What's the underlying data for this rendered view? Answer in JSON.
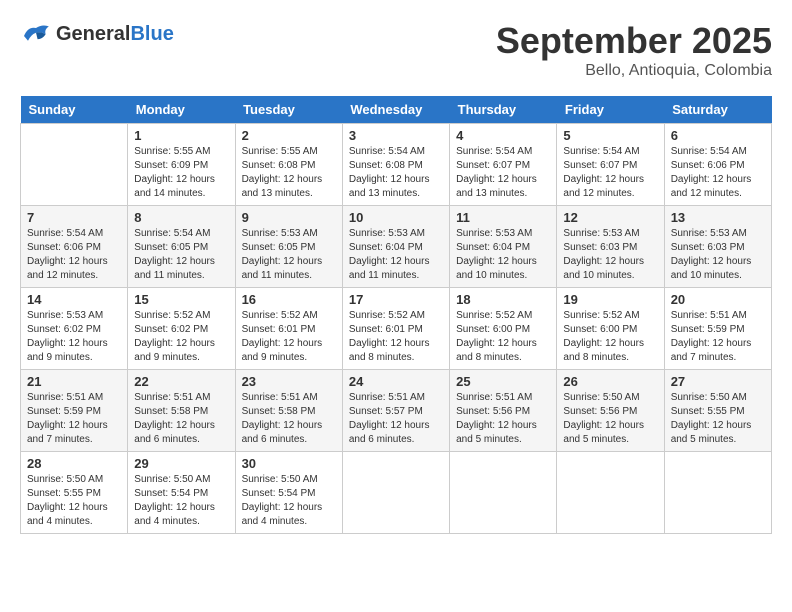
{
  "header": {
    "logo_general": "General",
    "logo_blue": "Blue",
    "month_title": "September 2025",
    "location": "Bello, Antioquia, Colombia"
  },
  "days_of_week": [
    "Sunday",
    "Monday",
    "Tuesday",
    "Wednesday",
    "Thursday",
    "Friday",
    "Saturday"
  ],
  "weeks": [
    [
      {
        "day": "",
        "info": ""
      },
      {
        "day": "1",
        "info": "Sunrise: 5:55 AM\nSunset: 6:09 PM\nDaylight: 12 hours\nand 14 minutes."
      },
      {
        "day": "2",
        "info": "Sunrise: 5:55 AM\nSunset: 6:08 PM\nDaylight: 12 hours\nand 13 minutes."
      },
      {
        "day": "3",
        "info": "Sunrise: 5:54 AM\nSunset: 6:08 PM\nDaylight: 12 hours\nand 13 minutes."
      },
      {
        "day": "4",
        "info": "Sunrise: 5:54 AM\nSunset: 6:07 PM\nDaylight: 12 hours\nand 13 minutes."
      },
      {
        "day": "5",
        "info": "Sunrise: 5:54 AM\nSunset: 6:07 PM\nDaylight: 12 hours\nand 12 minutes."
      },
      {
        "day": "6",
        "info": "Sunrise: 5:54 AM\nSunset: 6:06 PM\nDaylight: 12 hours\nand 12 minutes."
      }
    ],
    [
      {
        "day": "7",
        "info": "Sunrise: 5:54 AM\nSunset: 6:06 PM\nDaylight: 12 hours\nand 12 minutes."
      },
      {
        "day": "8",
        "info": "Sunrise: 5:54 AM\nSunset: 6:05 PM\nDaylight: 12 hours\nand 11 minutes."
      },
      {
        "day": "9",
        "info": "Sunrise: 5:53 AM\nSunset: 6:05 PM\nDaylight: 12 hours\nand 11 minutes."
      },
      {
        "day": "10",
        "info": "Sunrise: 5:53 AM\nSunset: 6:04 PM\nDaylight: 12 hours\nand 11 minutes."
      },
      {
        "day": "11",
        "info": "Sunrise: 5:53 AM\nSunset: 6:04 PM\nDaylight: 12 hours\nand 10 minutes."
      },
      {
        "day": "12",
        "info": "Sunrise: 5:53 AM\nSunset: 6:03 PM\nDaylight: 12 hours\nand 10 minutes."
      },
      {
        "day": "13",
        "info": "Sunrise: 5:53 AM\nSunset: 6:03 PM\nDaylight: 12 hours\nand 10 minutes."
      }
    ],
    [
      {
        "day": "14",
        "info": "Sunrise: 5:53 AM\nSunset: 6:02 PM\nDaylight: 12 hours\nand 9 minutes."
      },
      {
        "day": "15",
        "info": "Sunrise: 5:52 AM\nSunset: 6:02 PM\nDaylight: 12 hours\nand 9 minutes."
      },
      {
        "day": "16",
        "info": "Sunrise: 5:52 AM\nSunset: 6:01 PM\nDaylight: 12 hours\nand 9 minutes."
      },
      {
        "day": "17",
        "info": "Sunrise: 5:52 AM\nSunset: 6:01 PM\nDaylight: 12 hours\nand 8 minutes."
      },
      {
        "day": "18",
        "info": "Sunrise: 5:52 AM\nSunset: 6:00 PM\nDaylight: 12 hours\nand 8 minutes."
      },
      {
        "day": "19",
        "info": "Sunrise: 5:52 AM\nSunset: 6:00 PM\nDaylight: 12 hours\nand 8 minutes."
      },
      {
        "day": "20",
        "info": "Sunrise: 5:51 AM\nSunset: 5:59 PM\nDaylight: 12 hours\nand 7 minutes."
      }
    ],
    [
      {
        "day": "21",
        "info": "Sunrise: 5:51 AM\nSunset: 5:59 PM\nDaylight: 12 hours\nand 7 minutes."
      },
      {
        "day": "22",
        "info": "Sunrise: 5:51 AM\nSunset: 5:58 PM\nDaylight: 12 hours\nand 6 minutes."
      },
      {
        "day": "23",
        "info": "Sunrise: 5:51 AM\nSunset: 5:58 PM\nDaylight: 12 hours\nand 6 minutes."
      },
      {
        "day": "24",
        "info": "Sunrise: 5:51 AM\nSunset: 5:57 PM\nDaylight: 12 hours\nand 6 minutes."
      },
      {
        "day": "25",
        "info": "Sunrise: 5:51 AM\nSunset: 5:56 PM\nDaylight: 12 hours\nand 5 minutes."
      },
      {
        "day": "26",
        "info": "Sunrise: 5:50 AM\nSunset: 5:56 PM\nDaylight: 12 hours\nand 5 minutes."
      },
      {
        "day": "27",
        "info": "Sunrise: 5:50 AM\nSunset: 5:55 PM\nDaylight: 12 hours\nand 5 minutes."
      }
    ],
    [
      {
        "day": "28",
        "info": "Sunrise: 5:50 AM\nSunset: 5:55 PM\nDaylight: 12 hours\nand 4 minutes."
      },
      {
        "day": "29",
        "info": "Sunrise: 5:50 AM\nSunset: 5:54 PM\nDaylight: 12 hours\nand 4 minutes."
      },
      {
        "day": "30",
        "info": "Sunrise: 5:50 AM\nSunset: 5:54 PM\nDaylight: 12 hours\nand 4 minutes."
      },
      {
        "day": "",
        "info": ""
      },
      {
        "day": "",
        "info": ""
      },
      {
        "day": "",
        "info": ""
      },
      {
        "day": "",
        "info": ""
      }
    ]
  ]
}
